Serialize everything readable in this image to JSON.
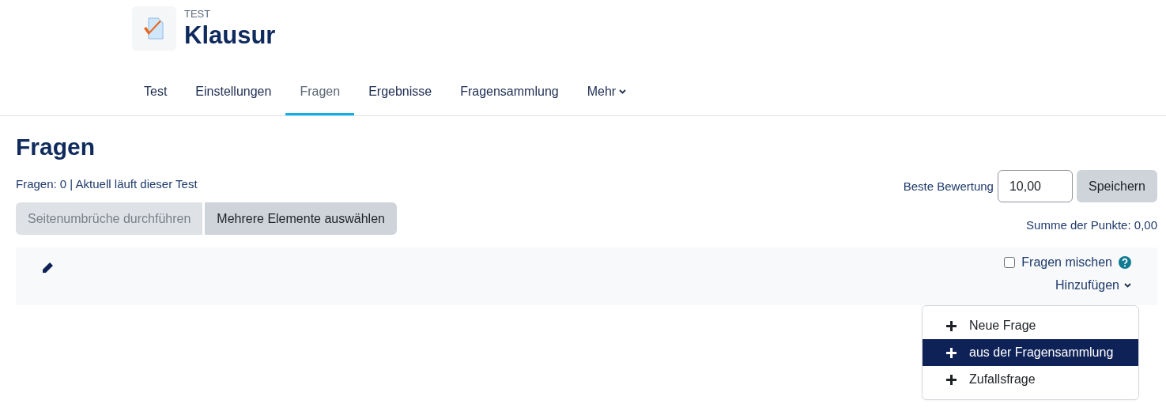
{
  "header": {
    "kicker": "TEST",
    "title": "Klausur"
  },
  "tabs": [
    {
      "label": "Test",
      "selected": false,
      "kind": "link"
    },
    {
      "label": "Einstellungen",
      "selected": false,
      "kind": "link"
    },
    {
      "label": "Fragen",
      "selected": true,
      "kind": "link"
    },
    {
      "label": "Ergebnisse",
      "selected": false,
      "kind": "link"
    },
    {
      "label": "Fragensammlung",
      "selected": false,
      "kind": "link"
    },
    {
      "label": "Mehr",
      "selected": false,
      "kind": "menu"
    }
  ],
  "page_title": "Fragen",
  "info": "Fragen: 0 | Aktuell läuft dieser Test",
  "buttons": [
    {
      "label": "Seitenumbrüche durchführen",
      "disabled": true
    },
    {
      "label": "Mehrere Elemente auswählen",
      "disabled": false
    }
  ],
  "grade": {
    "label": "Beste Bewertung",
    "value": "10,00",
    "save": "Speichern",
    "total": "Summe der Punkte: 0,00"
  },
  "section": {
    "shuffle_label": "Fragen mischen",
    "shuffle_checked": false,
    "add_label": "Hinzufügen"
  },
  "add_menu": {
    "expanded": true,
    "items": [
      {
        "label": "Neue Frage",
        "selected": false
      },
      {
        "label": "aus der Fragensammlung",
        "selected": true
      },
      {
        "label": "Zufallsfrage",
        "selected": false
      }
    ]
  }
}
